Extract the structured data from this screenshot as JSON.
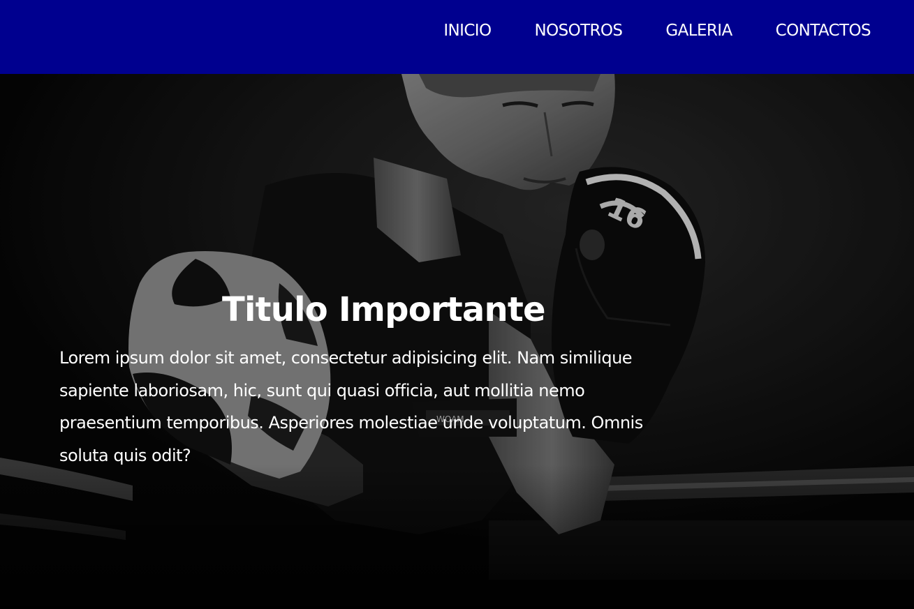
{
  "nav": {
    "items": [
      {
        "label": "INICIO"
      },
      {
        "label": "NOSOTROS"
      },
      {
        "label": "GALERIA"
      },
      {
        "label": "CONTACTOS"
      }
    ]
  },
  "hero": {
    "title": "Titulo Importante",
    "text": "Lorem ipsum dolor sit amet, consectetur adipisicing elit. Nam similique sapiente laboriosam, hic, sunt qui quasi officia, aut mollitia nemo praesentium temporibus. Asperiores molestiae unde voluptatum. Omnis soluta quis odit?",
    "glove_brand": "WOAM",
    "glove_number": "16",
    "image_description_hidden": null
  },
  "colors": {
    "navbar": "#00008f",
    "text": "#ffffff",
    "hero_background": "#080808"
  }
}
